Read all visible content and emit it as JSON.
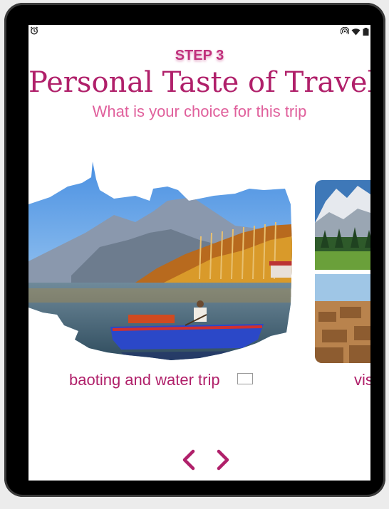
{
  "header": {
    "step_label": "STEP 3",
    "title": "Personal Taste of Travel",
    "subtitle": "What is your choice for this trip"
  },
  "status_bar": {
    "left_icons": [
      "alarm-icon"
    ],
    "right_icons": [
      "hotspot-icon",
      "wifi-icon",
      "battery-icon"
    ]
  },
  "cards": [
    {
      "label": "baoting and water trip",
      "checked": false,
      "image": "mountain-lake-boat-photo"
    },
    {
      "label": "vis",
      "image": "mountain-valley-and-desert-village-photo"
    }
  ],
  "navigation": {
    "prev_icon": "chevron-left-icon",
    "next_icon": "chevron-right-icon"
  },
  "colors": {
    "accent": "#b0206a",
    "subtitle": "#e0609c",
    "step": "#c0307c"
  }
}
